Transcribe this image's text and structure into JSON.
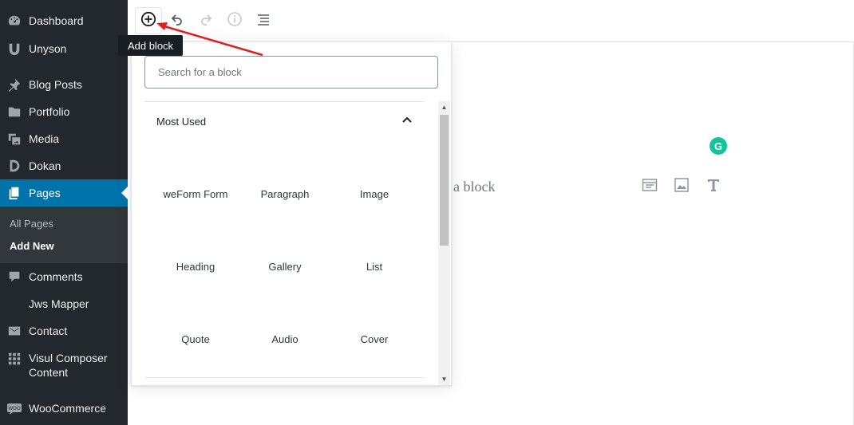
{
  "sidebar": {
    "items": [
      {
        "label": "Dashboard",
        "icon": "dashboard-icon"
      },
      {
        "label": "Unyson",
        "icon": "unyson-icon"
      },
      {
        "label": "Blog Posts",
        "icon": "pin-icon"
      },
      {
        "label": "Portfolio",
        "icon": "folder-icon"
      },
      {
        "label": "Media",
        "icon": "media-icon"
      },
      {
        "label": "Dokan",
        "icon": "dokan-icon"
      },
      {
        "label": "Pages",
        "icon": "pages-icon"
      },
      {
        "label": "Comments",
        "icon": "comment-icon"
      },
      {
        "label": "Jws Mapper",
        "icon": ""
      },
      {
        "label": "Contact",
        "icon": "mail-icon"
      },
      {
        "label": "Visul Composer Content",
        "label_line1": "Visul Composer",
        "label_line2": "Content",
        "icon": "grid-icon"
      },
      {
        "label": "WooCommerce",
        "icon": "woo-icon"
      }
    ],
    "submenu": [
      {
        "label": "All Pages"
      },
      {
        "label": "Add New"
      }
    ],
    "active_item": "Pages",
    "active_color": "#0073aa"
  },
  "toolbar": {
    "buttons": [
      "add-block",
      "undo",
      "redo",
      "info",
      "outline"
    ],
    "tooltip": "Add block"
  },
  "editor": {
    "placeholder_fragment": "a block",
    "inline_tools": [
      "layout-icon",
      "image-icon",
      "text-icon"
    ],
    "grammarly_letter": "G"
  },
  "inserter": {
    "search_placeholder": "Search for a block",
    "panel_title": "Most Used",
    "blocks": [
      {
        "label": "weForm Form"
      },
      {
        "label": "Paragraph"
      },
      {
        "label": "Image"
      },
      {
        "label": "Heading"
      },
      {
        "label": "Gallery"
      },
      {
        "label": "List"
      },
      {
        "label": "Quote"
      },
      {
        "label": "Audio"
      },
      {
        "label": "Cover"
      }
    ]
  },
  "colors": {
    "sidebar_bg": "#23282d",
    "accent": "#0073aa",
    "annotation": "#e02020"
  }
}
